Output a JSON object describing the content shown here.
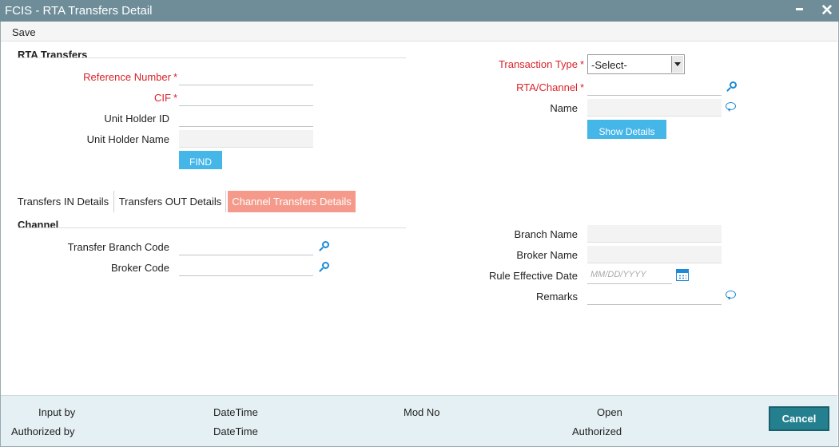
{
  "window": {
    "title": "FCIS - RTA Transfers Detail"
  },
  "menu": {
    "save_label": "Save"
  },
  "rta_section": {
    "title": "RTA Transfers",
    "reference_number_label": "Reference Number",
    "cif_label": "CIF",
    "unit_holder_id_label": "Unit Holder ID",
    "unit_holder_name_label": "Unit Holder Name",
    "find_label": "FIND",
    "transaction_type_label": "Transaction Type",
    "transaction_type_value": "-Select-",
    "rta_channel_label": "RTA/Channel",
    "name_label": "Name",
    "show_details_label": "Show Details",
    "required_mark": "*"
  },
  "tabs": [
    {
      "label": "Transfers IN Details",
      "active": false
    },
    {
      "label": "Transfers OUT Details",
      "active": false
    },
    {
      "label": "Channel Transfers Details",
      "active": true
    }
  ],
  "channel_section": {
    "title": "Channel",
    "transfer_branch_code_label": "Transfer Branch Code",
    "broker_code_label": "Broker Code",
    "branch_name_label": "Branch Name",
    "broker_name_label": "Broker Name",
    "rule_effective_date_label": "Rule Effective Date",
    "rule_effective_date_placeholder": "MM/DD/YYYY",
    "remarks_label": "Remarks"
  },
  "footer": {
    "input_by": "Input by",
    "authorized_by": "Authorized by",
    "datetime_1": "DateTime",
    "datetime_2": "DateTime",
    "mod_no": "Mod No",
    "open": "Open",
    "authorized": "Authorized",
    "cancel_label": "Cancel"
  },
  "colors": {
    "titlebar": "#6e8d99",
    "required": "#d8232a",
    "accent_blue": "#45b6e8",
    "active_tab": "#f59a8b",
    "cancel_button": "#247f8f",
    "footer_bg": "#e5f0f4"
  }
}
